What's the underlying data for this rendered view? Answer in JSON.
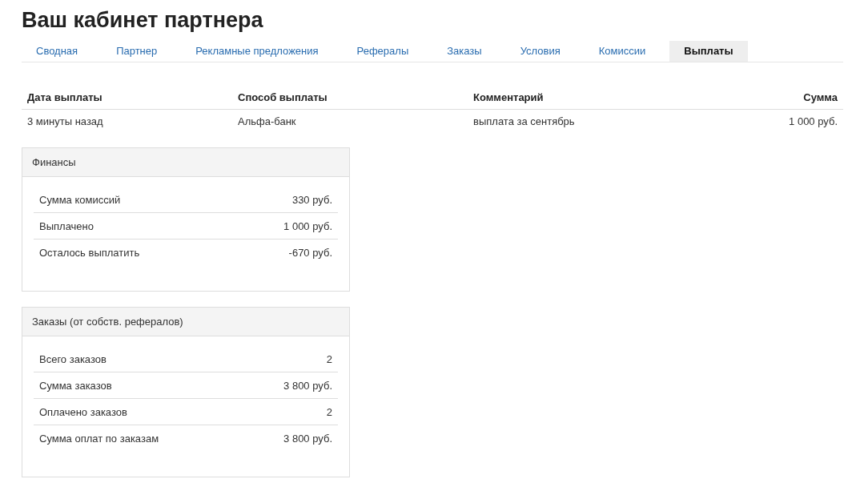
{
  "title": "Ваш кабинет партнера",
  "tabs": [
    {
      "label": "Сводная",
      "selected": false
    },
    {
      "label": "Партнер",
      "selected": false
    },
    {
      "label": "Рекламные предложения",
      "selected": false
    },
    {
      "label": "Рефералы",
      "selected": false
    },
    {
      "label": "Заказы",
      "selected": false
    },
    {
      "label": "Условия",
      "selected": false
    },
    {
      "label": "Комиссии",
      "selected": false
    },
    {
      "label": "Выплаты",
      "selected": true
    }
  ],
  "payouts": {
    "columns": [
      "Дата выплаты",
      "Способ выплаты",
      "Комментарий",
      "Сумма"
    ],
    "rows": [
      [
        "3 минуты назад",
        "Альфа-банк",
        "выплата за сентябрь",
        "1 000 руб."
      ]
    ]
  },
  "panels": [
    {
      "title": "Финансы",
      "rows": [
        {
          "label": "Сумма комиссий",
          "value": "330 руб."
        },
        {
          "label": "Выплачено",
          "value": "1 000 руб."
        },
        {
          "label": "Осталось выплатить",
          "value": "-670 руб."
        }
      ]
    },
    {
      "title": "Заказы (от собств. рефералов)",
      "rows": [
        {
          "label": "Всего заказов",
          "value": "2"
        },
        {
          "label": "Сумма заказов",
          "value": "3 800 руб."
        },
        {
          "label": "Оплачено заказов",
          "value": "2"
        },
        {
          "label": "Сумма оплат по заказам",
          "value": "3 800 руб."
        }
      ]
    }
  ]
}
